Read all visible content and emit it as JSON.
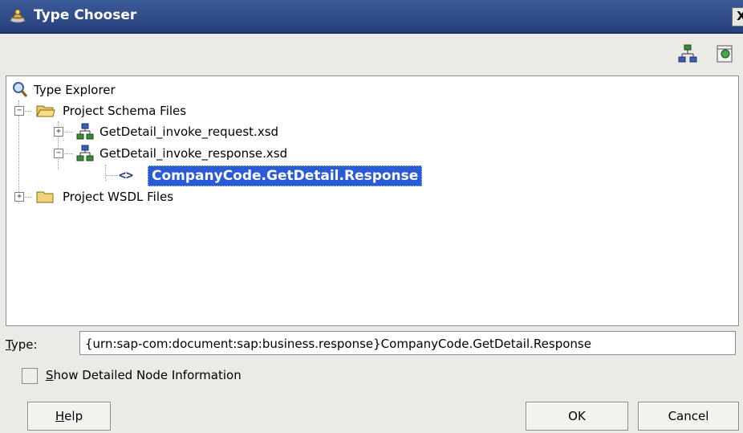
{
  "window": {
    "title": "Type Chooser",
    "close_label": "X"
  },
  "toolbar": {
    "buttons": [
      {
        "icon": "schema-tree-icon"
      },
      {
        "icon": "import-schema-icon"
      }
    ]
  },
  "tree": {
    "root": {
      "label": "Type Explorer",
      "icon": "search-icon"
    },
    "nodes": [
      {
        "label": "Project Schema Files",
        "icon": "open-folder-icon",
        "expanded": true
      },
      {
        "label": "GetDetail_invoke_request.xsd",
        "icon": "schema-icon",
        "expanded": false
      },
      {
        "label": "GetDetail_invoke_response.xsd",
        "icon": "schema-icon",
        "expanded": true
      },
      {
        "label": "CompanyCode.GetDetail.Response",
        "icon": "element-icon",
        "selected": true
      },
      {
        "label": "Project WSDL Files",
        "icon": "folder-icon",
        "expanded": false
      }
    ]
  },
  "type_field": {
    "label_prefix": "T",
    "label_rest": "ype:",
    "value": "{urn:sap-com:document:sap:business.response}CompanyCode.GetDetail.Response"
  },
  "options": {
    "show_detailed_prefix": "S",
    "show_detailed_rest": "how Detailed Node Information",
    "checked": false
  },
  "buttons": {
    "help_prefix": "H",
    "help_rest": "elp",
    "ok": "OK",
    "cancel": "Cancel"
  },
  "colors": {
    "titlebar": "#2d4a8a",
    "selection": "#2a5bd6",
    "dialog_bg": "#ebeae6"
  }
}
